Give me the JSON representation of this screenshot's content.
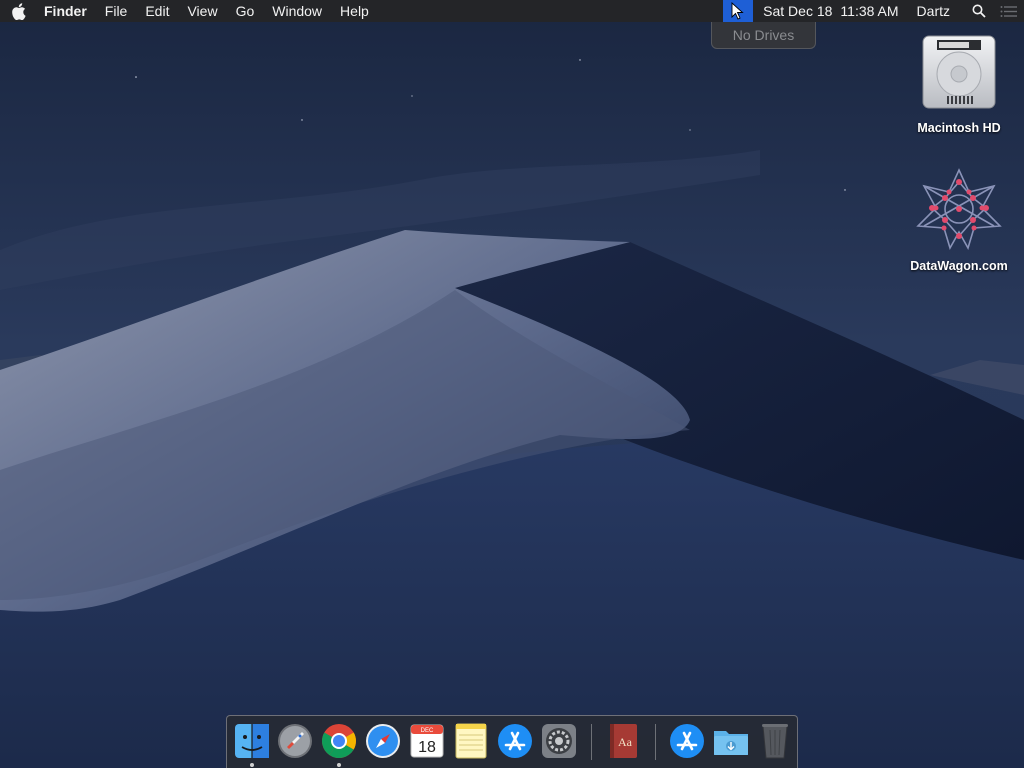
{
  "menubar": {
    "app_name": "Finder",
    "menus": [
      "File",
      "Edit",
      "View",
      "Go",
      "Window",
      "Help"
    ],
    "date": "Sat Dec 18",
    "time": "11:38 AM",
    "user": "Dartz",
    "icons": [
      "apple-logo-icon",
      "drive-status-icon",
      "spotlight-search-icon",
      "notification-center-icon"
    ]
  },
  "dropdown": {
    "item": "No Drives"
  },
  "desktop": {
    "icons": [
      {
        "label": "Macintosh HD",
        "icon": "hard-drive-icon"
      },
      {
        "label": "DataWagon.com",
        "icon": "network-star-icon"
      }
    ]
  },
  "dock": {
    "apps": [
      {
        "name": "finder-icon",
        "running": true
      },
      {
        "name": "launchpad-icon",
        "running": false
      },
      {
        "name": "chrome-icon",
        "running": true
      },
      {
        "name": "safari-icon",
        "running": false
      },
      {
        "name": "calendar-icon",
        "running": false,
        "month": "DEC",
        "day": "18"
      },
      {
        "name": "notes-icon",
        "running": false
      },
      {
        "name": "app-store-icon",
        "running": false
      },
      {
        "name": "system-preferences-icon",
        "running": false
      },
      {
        "name": "dictionary-icon",
        "running": false,
        "text": "Aa"
      },
      {
        "name": "applications-folder-icon",
        "running": false
      },
      {
        "name": "downloads-folder-icon",
        "running": false
      },
      {
        "name": "trash-icon",
        "running": false
      }
    ]
  },
  "colors": {
    "menubar": "#242528",
    "highlight": "#1e5fd6",
    "dropdown_text": "#8a8c90"
  }
}
